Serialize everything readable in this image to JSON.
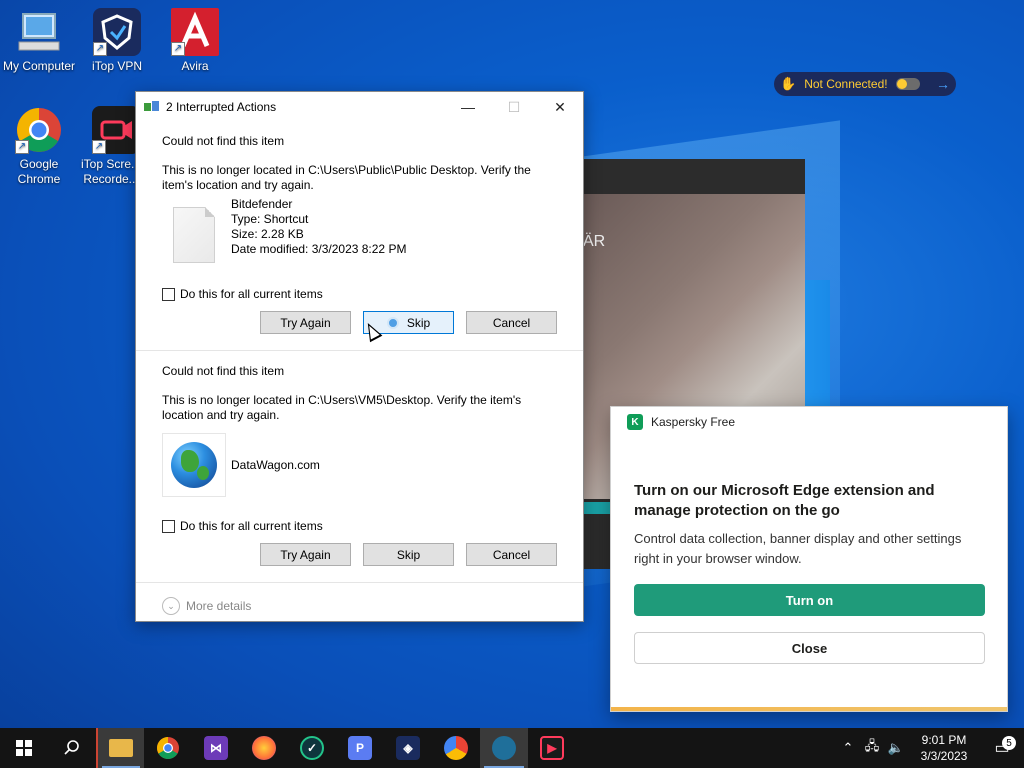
{
  "desktop": {
    "icons": [
      {
        "label": "My Computer"
      },
      {
        "label": "iTop VPN"
      },
      {
        "label": "Avira"
      },
      {
        "label": "Google Chrome"
      },
      {
        "label": "iTop Scre... Recorde..."
      }
    ]
  },
  "vpn_widget": {
    "status": "Not Connected!"
  },
  "background_window": {
    "partial_text": "ÄR"
  },
  "dialog": {
    "title": "2 Interrupted Actions",
    "items": [
      {
        "heading": "Could not find this item",
        "description": "This is no longer located in C:\\Users\\Public\\Public Desktop. Verify the item's location and try again.",
        "file_name": "Bitdefender",
        "file_type": "Type: Shortcut",
        "file_size": "Size: 2.28 KB",
        "file_date": "Date modified: 3/3/2023 8:22 PM",
        "checkbox_label": "Do this for all current items",
        "try_again": "Try Again",
        "skip": "Skip",
        "cancel": "Cancel"
      },
      {
        "heading": "Could not find this item",
        "description": "This is no longer located in C:\\Users\\VM5\\Desktop. Verify the item's location and try again.",
        "file_name": "DataWagon.com",
        "checkbox_label": "Do this for all current items",
        "try_again": "Try Again",
        "skip": "Skip",
        "cancel": "Cancel"
      }
    ],
    "more_details": "More details"
  },
  "kaspersky": {
    "app_name": "Kaspersky Free",
    "title": "Turn on our Microsoft Edge extension and manage protection on the go",
    "body": "Control data collection, banner display and other settings right in your browser window.",
    "turn_on": "Turn on",
    "close": "Close",
    "accent": "#1f9b7a"
  },
  "taskbar": {
    "clock_time": "9:01 PM",
    "clock_date": "3/3/2023",
    "notification_count": "5"
  }
}
